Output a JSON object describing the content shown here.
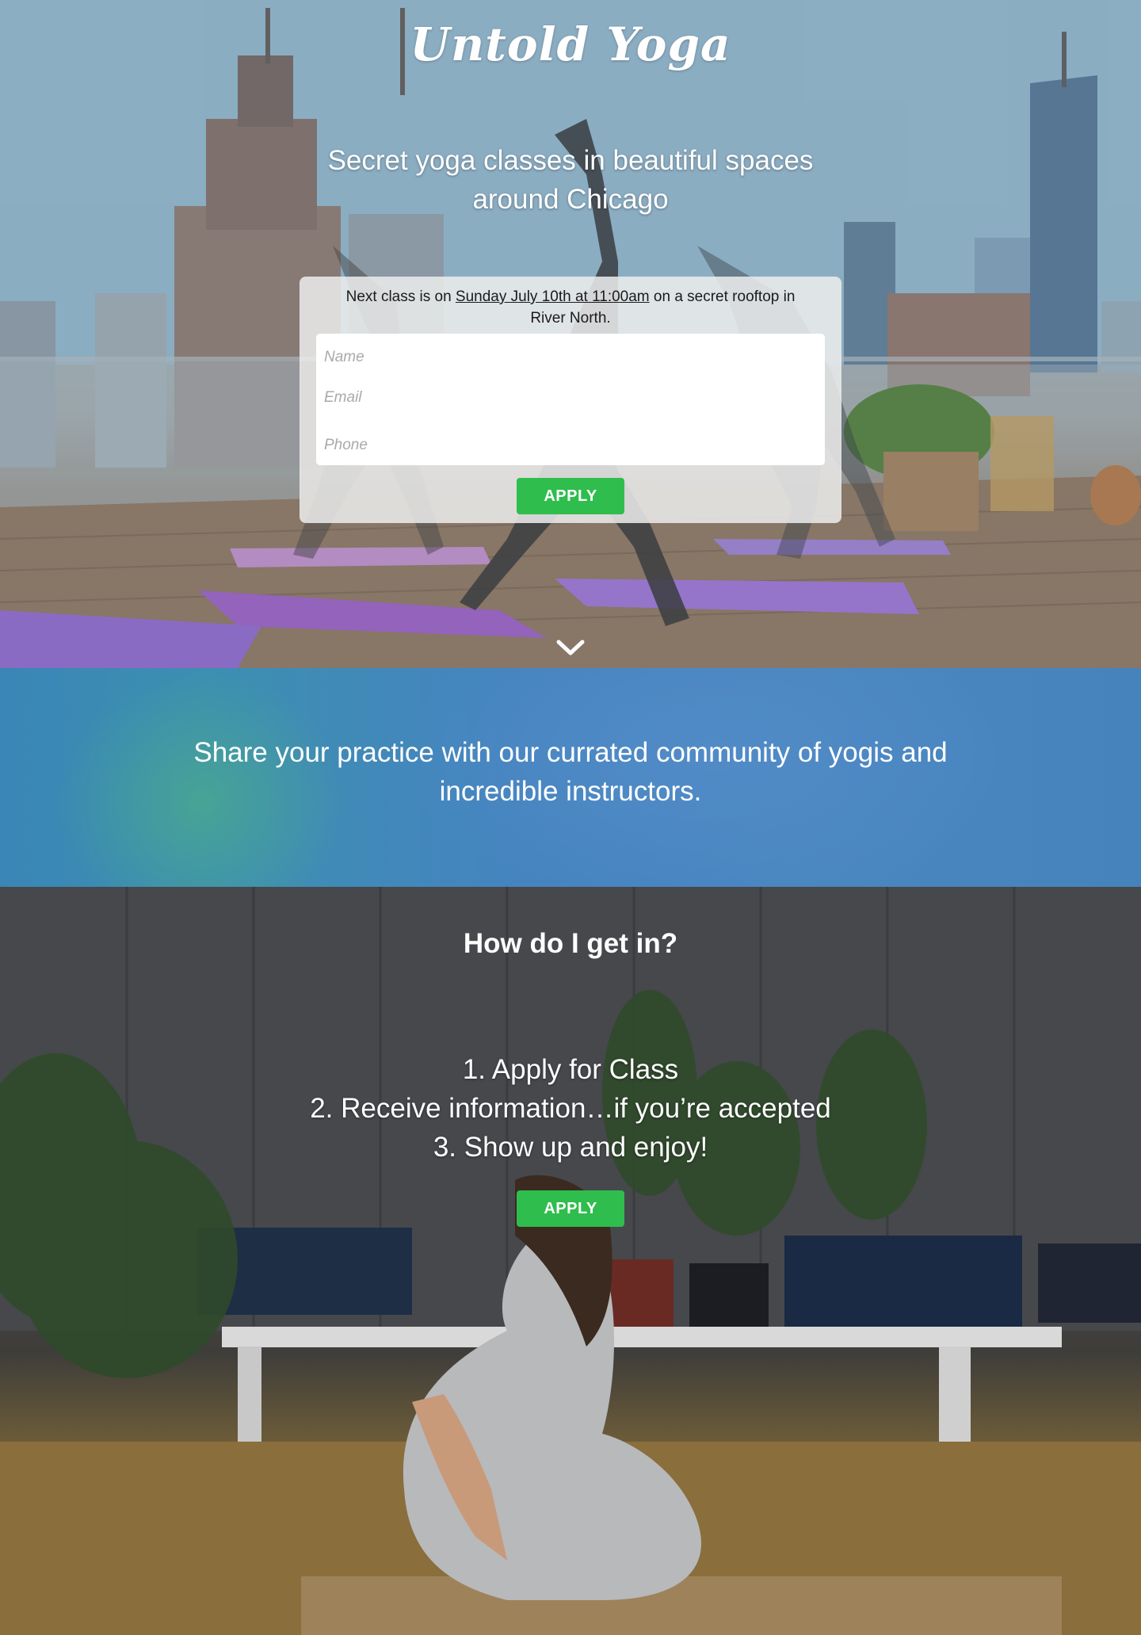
{
  "hero": {
    "brand": "Untold Yoga",
    "tagline": "Secret yoga classes in beautiful spaces around Chicago",
    "next_class": {
      "prefix": "Next class is on ",
      "date": "Sunday July 10th at 11:00am",
      "suffix": " on a secret rooftop in River North."
    },
    "form": {
      "name_placeholder": "Name",
      "email_placeholder": "Email",
      "phone_placeholder": "Phone",
      "apply_label": "APPLY"
    },
    "scroll_icon": "chevron-down-icon"
  },
  "community": {
    "text": "Share your practice with our currated community of yogis and incredible instructors."
  },
  "how": {
    "title": "How do I get in?",
    "steps": [
      "1. Apply for Class",
      "2. Receive information…if you’re accepted",
      "3. Show up and enjoy!"
    ],
    "apply_label": "APPLY"
  },
  "colors": {
    "accent_green": "#2fbd4e",
    "band_blue": "#4a86c0"
  }
}
